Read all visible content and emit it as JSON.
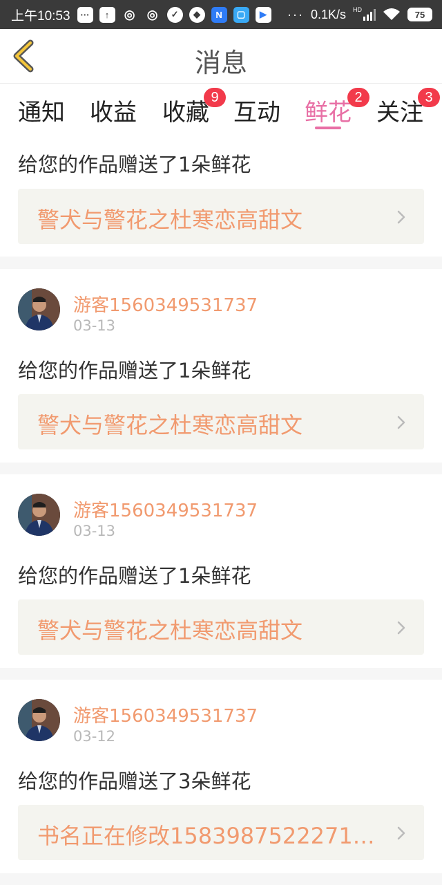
{
  "status_bar": {
    "time": "上午10:53",
    "net_speed": "0.1K/s",
    "net_hd": "HD",
    "battery": "75",
    "dots": "···"
  },
  "header": {
    "title": "消息",
    "back_icon": "chevron-left-icon",
    "accent_color": "#f4c63b"
  },
  "tabs": [
    {
      "label": "通知",
      "badge": null
    },
    {
      "label": "收益",
      "badge": null
    },
    {
      "label": "收藏",
      "badge": "9"
    },
    {
      "label": "互动",
      "badge": null
    },
    {
      "label": "鲜花",
      "badge": "2",
      "active": true
    },
    {
      "label": "关注",
      "badge": "3"
    }
  ],
  "colors": {
    "active_tab": "#e86fa5",
    "badge": "#f23a4b",
    "username": "#f19a6f",
    "book_title": "#f19a6f"
  },
  "messages": [
    {
      "text": "给您的作品赠送了1朵鲜花",
      "book": "警犬与警花之杜寒恋高甜文"
    },
    {
      "user": "游客1560349531737",
      "date": "03-13",
      "text": "给您的作品赠送了1朵鲜花",
      "book": "警犬与警花之杜寒恋高甜文"
    },
    {
      "user": "游客1560349531737",
      "date": "03-13",
      "text": "给您的作品赠送了1朵鲜花",
      "book": "警犬与警花之杜寒恋高甜文"
    },
    {
      "user": "游客1560349531737",
      "date": "03-12",
      "text": "给您的作品赠送了3朵鲜花",
      "book": "书名正在修改1583987522271…"
    }
  ]
}
